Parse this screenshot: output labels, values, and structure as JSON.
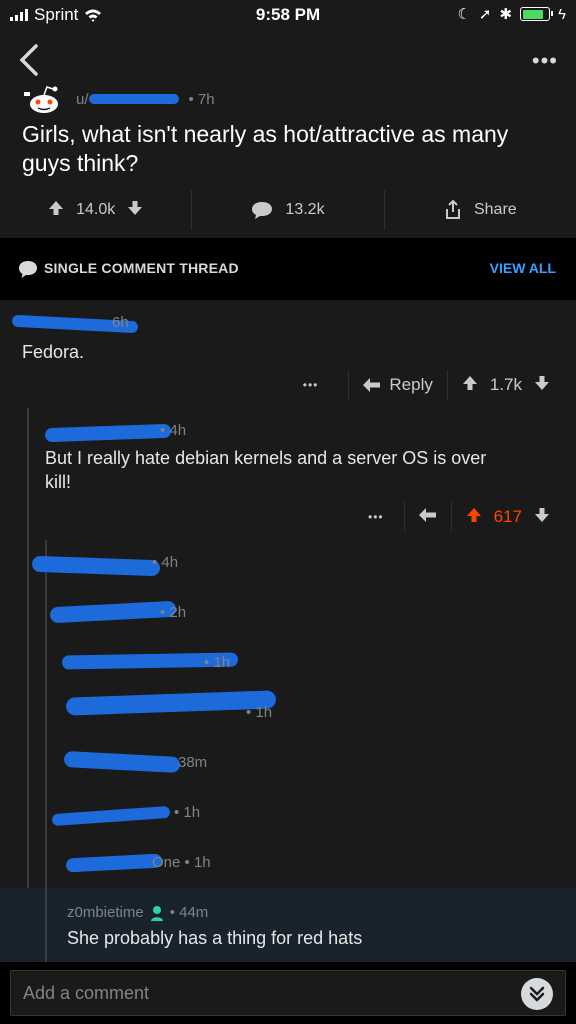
{
  "status": {
    "carrier": "Sprint",
    "time": "9:58 PM"
  },
  "post": {
    "subreddit_partial": "u/",
    "age": "• 7h",
    "title": "Girls, what isn't nearly as hot/attractive as many guys think?",
    "upvotes": "14.0k",
    "comments": "13.2k",
    "share": "Share"
  },
  "thread_bar": {
    "label": "SINGLE COMMENT THREAD",
    "view_all": "VIEW ALL"
  },
  "comments": [
    {
      "meta": "6h",
      "body": "Fedora.",
      "reply": "Reply",
      "score": "1.7k"
    },
    {
      "meta": "• 4h",
      "body": "But I really hate debian kernels and a server OS is over kill!",
      "score": "617"
    }
  ],
  "collapsed": [
    {
      "meta": "• 4h"
    },
    {
      "meta": "• 2h"
    },
    {
      "meta": "• 1h"
    },
    {
      "meta": "• 1h"
    },
    {
      "meta": "38m"
    },
    {
      "meta": "• 1h"
    },
    {
      "meta": "One • 1h"
    }
  ],
  "highlighted": {
    "user": "z0mbietime",
    "age": "• 44m",
    "body": "She probably has a thing for red hats"
  },
  "composer": {
    "placeholder": "Add a comment"
  },
  "colors": {
    "upvote_active": "#ff4500",
    "accent": "#3aa0ff",
    "redaction": "#1e6fe6"
  }
}
